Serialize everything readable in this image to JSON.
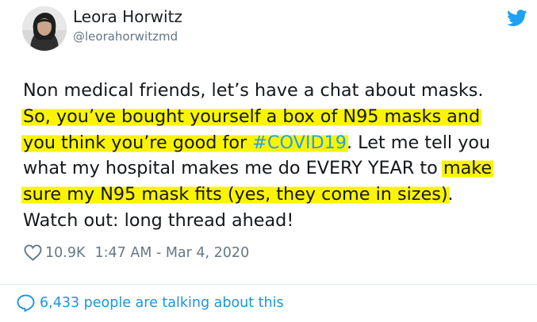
{
  "author": {
    "name": "Leora Horwitz",
    "handle": "@leorahorwitzmd"
  },
  "tweet": {
    "lines": [
      [
        {
          "text": "Non medical friends, let’s have a chat about masks.",
          "hl": false
        }
      ],
      [
        {
          "text": "So, you’ve bought yourself a box of N95 masks and",
          "hl": true
        }
      ],
      [
        {
          "text": "you think you’re good for ",
          "hl": true
        },
        {
          "text": "#COVID19",
          "hl": true,
          "hashtag": true
        },
        {
          "text": ". Let me tell you",
          "hl": false
        }
      ],
      [
        {
          "text": "what my hospital makes me do EVERY YEAR to ",
          "hl": false
        },
        {
          "text": "make",
          "hl": true
        }
      ],
      [
        {
          "text": "sure my N95 mask fits (yes, they come in sizes)",
          "hl": true
        },
        {
          "text": ".",
          "hl": false
        }
      ],
      [
        {
          "text": "Watch out: long thread ahead!",
          "hl": false
        }
      ]
    ]
  },
  "meta": {
    "likes": "10.9K",
    "timestamp": "1:47 AM - Mar 4, 2020"
  },
  "footer": {
    "talking": "6,433 people are talking about this"
  },
  "colors": {
    "highlight": "#fbf400",
    "hashtag": "#1da1f2",
    "link": "#1b95e0",
    "secondary_text": "#657786",
    "twitter_blue": "#1da1f2"
  },
  "icons": [
    "twitter-bird-icon",
    "heart-icon",
    "speech-bubble-icon"
  ]
}
